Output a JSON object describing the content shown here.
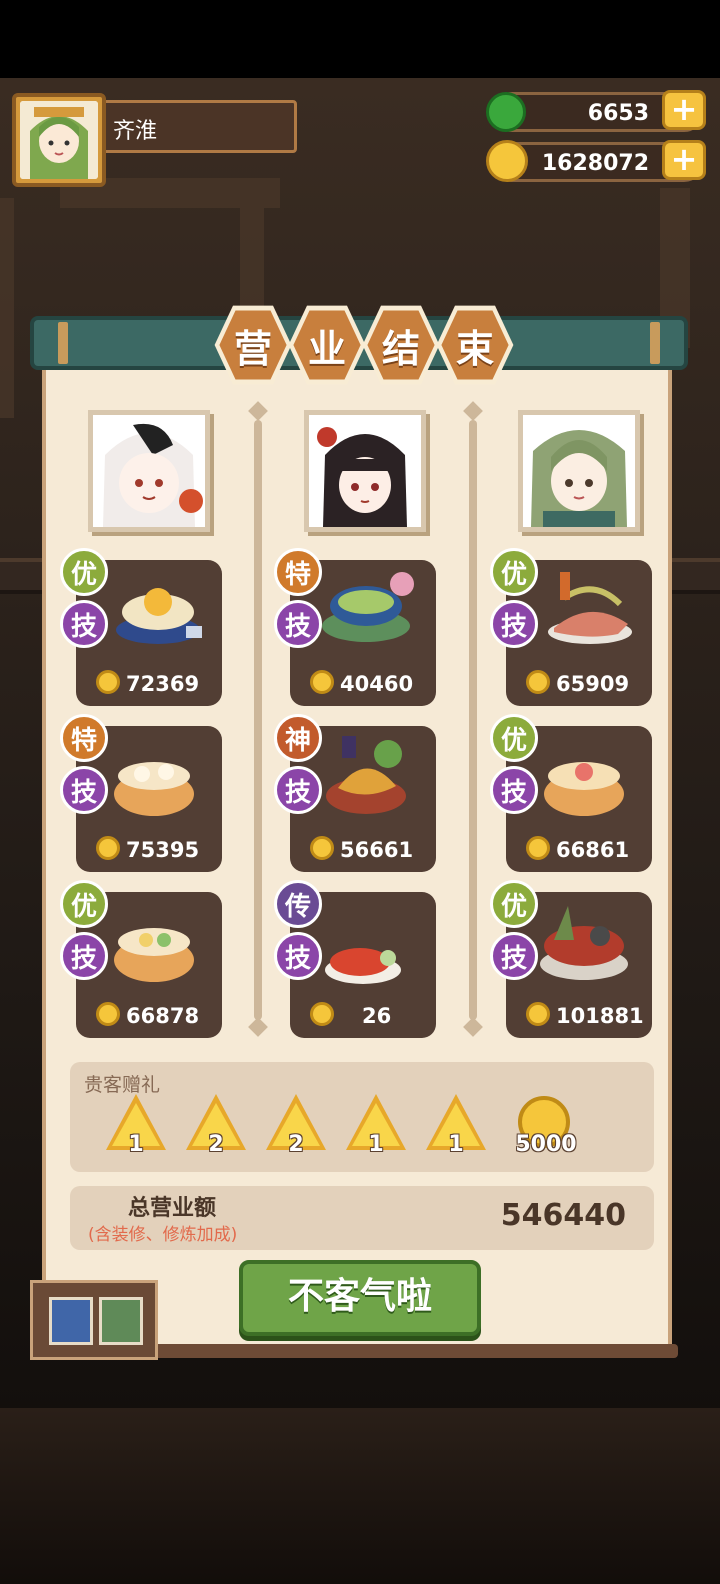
{
  "player": {
    "name": "齐淮"
  },
  "resources": {
    "jade": {
      "value": "6653",
      "icon": "green-jade-icon"
    },
    "coins": {
      "value": "1628072",
      "icon": "gold-coin-icon"
    }
  },
  "title_chars": [
    "营",
    "业",
    "结",
    "束"
  ],
  "columns": [
    {
      "chef": "white-haired-chef-portrait",
      "dishes": [
        {
          "grade": "优",
          "skill": "技",
          "amount": "72369",
          "color": "#8cab3c"
        },
        {
          "grade": "特",
          "skill": "技",
          "amount": "75395",
          "color": "#d07a2b"
        },
        {
          "grade": "优",
          "skill": "技",
          "amount": "66878",
          "color": "#8cab3c"
        }
      ]
    },
    {
      "chef": "black-haired-chef-portrait",
      "dishes": [
        {
          "grade": "特",
          "skill": "技",
          "amount": "40460",
          "color": "#d07a2b"
        },
        {
          "grade": "神",
          "skill": "技",
          "amount": "56661",
          "color": "#c25b2c"
        },
        {
          "grade": "传",
          "skill": "技",
          "amount": "26",
          "color": "#6a4b94"
        }
      ]
    },
    {
      "chef": "green-haired-chef-portrait",
      "dishes": [
        {
          "grade": "优",
          "skill": "技",
          "amount": "65909",
          "color": "#8cab3c"
        },
        {
          "grade": "优",
          "skill": "技",
          "amount": "66861",
          "color": "#8cab3c"
        },
        {
          "grade": "优",
          "skill": "技",
          "amount": "101881",
          "color": "#8cab3c"
        }
      ]
    }
  ],
  "gifts": {
    "title": "贵客赠礼",
    "items": [
      {
        "icon": "coral-token-icon",
        "count": "1"
      },
      {
        "icon": "coral-token-icon",
        "count": "2"
      },
      {
        "icon": "shell-token-icon",
        "count": "2"
      },
      {
        "icon": "flame-token-icon",
        "count": "1"
      },
      {
        "icon": "flame-token-icon",
        "count": "1"
      },
      {
        "icon": "gold-coin-icon",
        "count": "5000"
      }
    ]
  },
  "total": {
    "label": "总营业额",
    "note": "(含装修、修炼加成)",
    "value": "546440"
  },
  "confirm_button": "不客气啦"
}
